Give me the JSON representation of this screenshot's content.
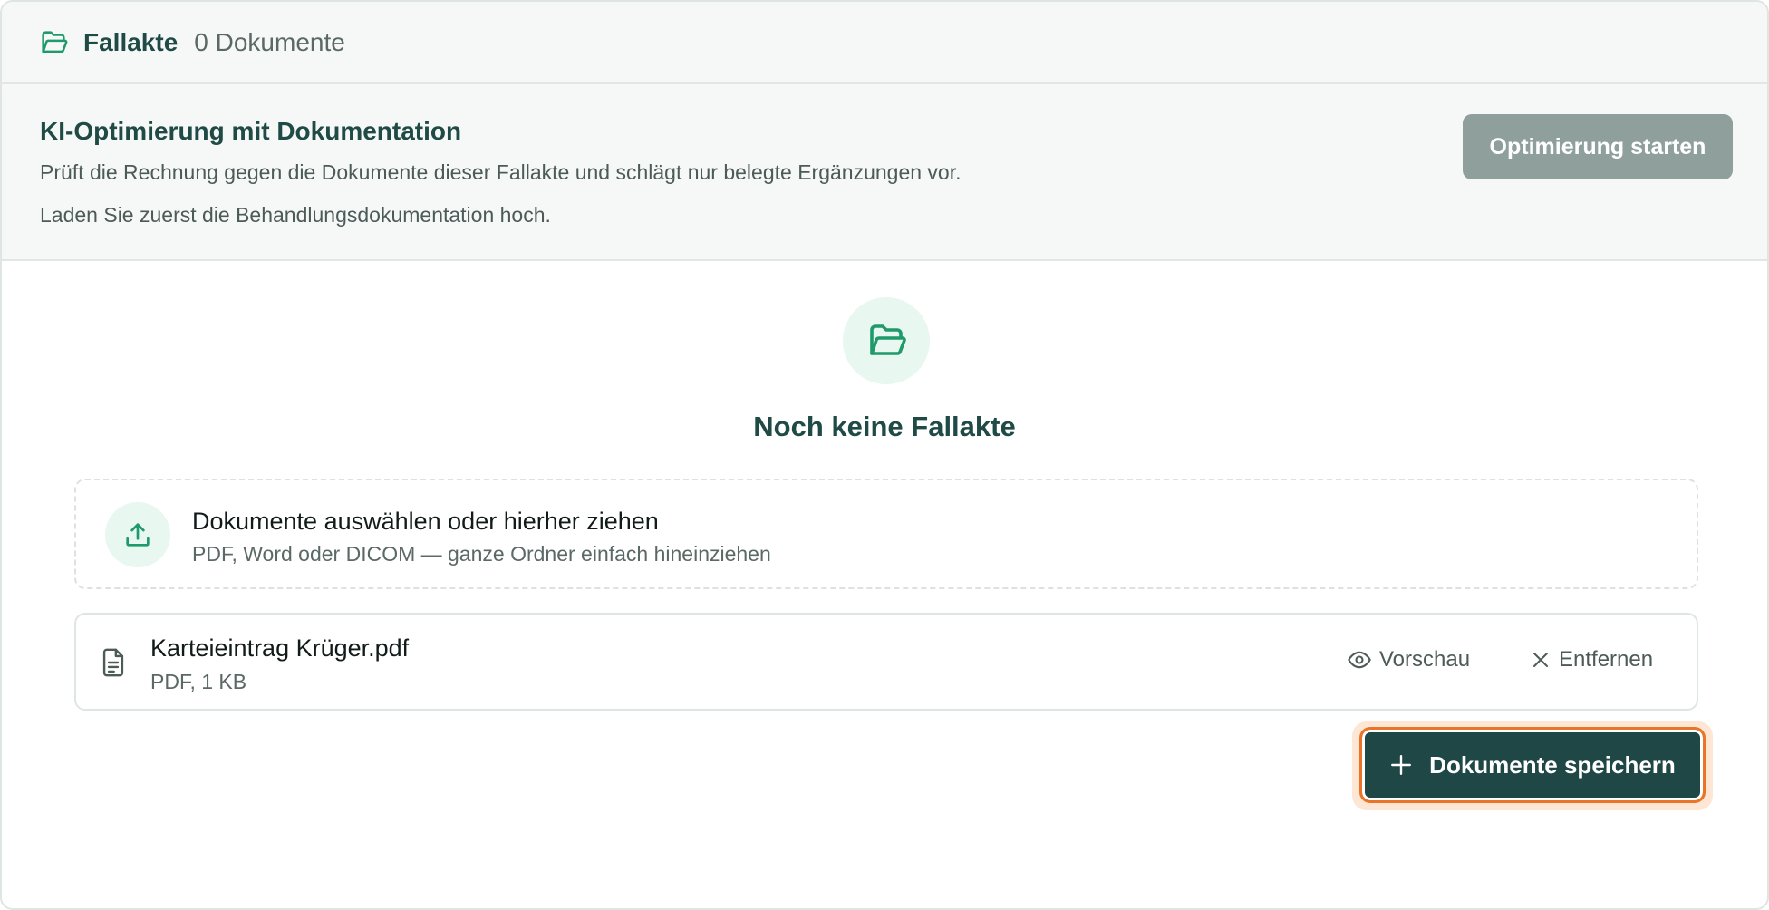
{
  "header": {
    "title": "Fallakte",
    "count": "0 Dokumente"
  },
  "optimization": {
    "heading": "KI-Optimierung mit Dokumentation",
    "description": "Prüft die Rechnung gegen die Dokumente dieser Fallakte und schlägt nur belegte Ergänzungen vor.",
    "hint": "Laden Sie zuerst die Behandlungsdokumentation hoch.",
    "start_label": "Optimierung starten"
  },
  "empty_state": {
    "title": "Noch keine Fallakte"
  },
  "dropzone": {
    "title": "Dokumente auswählen oder hierher ziehen",
    "subtitle": "PDF, Word oder DICOM — ganze Ordner einfach hineinziehen"
  },
  "files": [
    {
      "name": "Karteieintrag Krüger.pdf",
      "meta": "PDF, 1 KB",
      "preview_label": "Vorschau",
      "remove_label": "Entfernen"
    }
  ],
  "save_label": "Dokumente speichern",
  "colors": {
    "primary": "#1e4745",
    "accent_green": "#1f9a6a",
    "focus_ring": "#ea7428",
    "disabled_button": "#8fa09c"
  },
  "icons": {
    "header": "folder-open-icon",
    "empty_state": "folder-open-icon",
    "dropzone": "upload-icon",
    "file": "document-icon",
    "preview": "eye-icon",
    "remove": "close-icon",
    "save": "plus-icon"
  }
}
